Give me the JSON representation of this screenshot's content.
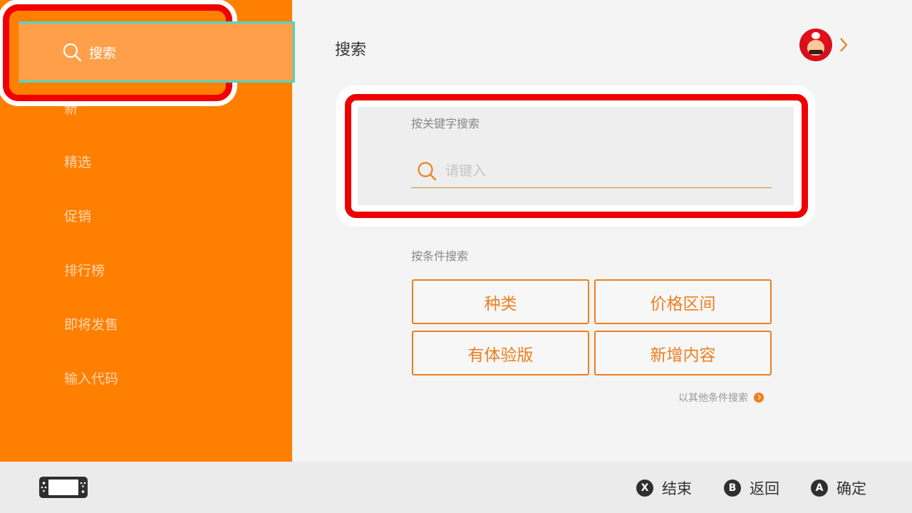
{
  "sidebar": {
    "selected_label": "搜索",
    "items": [
      {
        "label": "新"
      },
      {
        "label": "精选"
      },
      {
        "label": "促销"
      },
      {
        "label": "排行榜"
      },
      {
        "label": "即将发售"
      },
      {
        "label": "输入代码"
      }
    ]
  },
  "main": {
    "title": "搜索",
    "keyword_section": {
      "label": "按关键字搜索",
      "placeholder": "请键入",
      "value": ""
    },
    "condition_section": {
      "label": "按条件搜索",
      "buttons": [
        "种类",
        "价格区间",
        "有体验版",
        "新增内容"
      ],
      "other_link": "以其他条件搜索"
    }
  },
  "footer": {
    "hints": [
      {
        "key": "X",
        "label": "结束"
      },
      {
        "key": "B",
        "label": "返回"
      },
      {
        "key": "A",
        "label": "确定"
      }
    ]
  },
  "colors": {
    "sidebar": "#ff7f00",
    "accent": "#ee7f1e",
    "highlight": "#ee0000"
  }
}
